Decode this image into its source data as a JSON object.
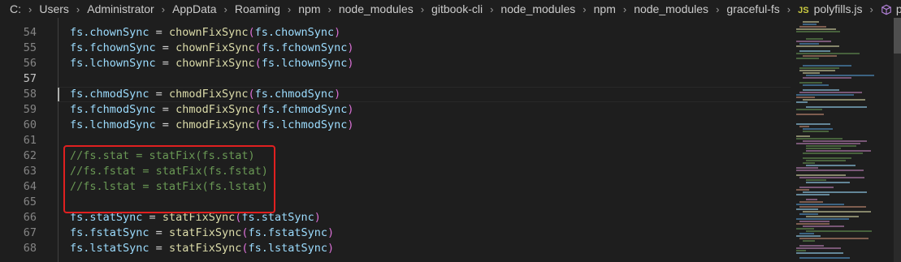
{
  "breadcrumb": {
    "items": [
      "C:",
      "Users",
      "Administrator",
      "AppData",
      "Roaming",
      "npm",
      "node_modules",
      "gitbook-cli",
      "node_modules",
      "npm",
      "node_modules",
      "graceful-fs"
    ],
    "file_icon": "JS",
    "file": "polyfills.js",
    "symbol": "patch"
  },
  "editor": {
    "line_numbers": [
      "54",
      "55",
      "56",
      "57",
      "58",
      "59",
      "60",
      "61",
      "62",
      "63",
      "64",
      "65",
      "66",
      "67",
      "68"
    ],
    "active_line": "57",
    "lines": {
      "l54": {
        "obj": "fs",
        "prop": ".chownSync",
        "eq": " = ",
        "fn": "chownFixSync",
        "open": "(",
        "arg": "fs.chownSync",
        "close": ")"
      },
      "l55": {
        "obj": "fs",
        "prop": ".fchownSync",
        "eq": " = ",
        "fn": "chownFixSync",
        "open": "(",
        "arg": "fs.fchownSync",
        "close": ")"
      },
      "l56": {
        "obj": "fs",
        "prop": ".lchownSync",
        "eq": " = ",
        "fn": "chownFixSync",
        "open": "(",
        "arg": "fs.lchownSync",
        "close": ")"
      },
      "l58": {
        "obj": "fs",
        "prop": ".chmodSync",
        "eq": " = ",
        "fn": "chmodFixSync",
        "open": "(",
        "arg": "fs.chmodSync",
        "close": ")"
      },
      "l59": {
        "obj": "fs",
        "prop": ".fchmodSync",
        "eq": " = ",
        "fn": "chmodFixSync",
        "open": "(",
        "arg": "fs.fchmodSync",
        "close": ")"
      },
      "l60": {
        "obj": "fs",
        "prop": ".lchmodSync",
        "eq": " = ",
        "fn": "chmodFixSync",
        "open": "(",
        "arg": "fs.lchmodSync",
        "close": ")"
      },
      "l62": "//fs.stat = statFix(fs.stat)",
      "l63": "//fs.fstat = statFix(fs.fstat)",
      "l64": "//fs.lstat = statFix(fs.lstat)",
      "l66": {
        "obj": "fs",
        "prop": ".statSync",
        "eq": " = ",
        "fn": "statFixSync",
        "open": "(",
        "arg": "fs.statSync",
        "close": ")"
      },
      "l67": {
        "obj": "fs",
        "prop": ".fstatSync",
        "eq": " = ",
        "fn": "statFixSync",
        "open": "(",
        "arg": "fs.fstatSync",
        "close": ")"
      },
      "l68": {
        "obj": "fs",
        "prop": ".lstatSync",
        "eq": " = ",
        "fn": "statFixSync",
        "open": "(",
        "arg": "fs.lstatSync",
        "close": ")"
      }
    }
  },
  "colors": {
    "background": "#1e1e1e",
    "comment": "#6a9955",
    "function": "#dcdcaa",
    "variable": "#9cdcfe",
    "bracket": "#da70d6",
    "annotation_box": "#e02020"
  }
}
